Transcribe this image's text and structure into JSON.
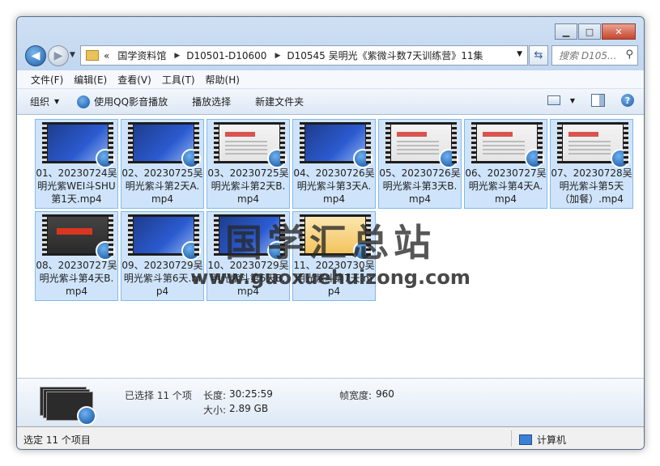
{
  "window": {
    "caption_buttons": [
      "▁",
      "□",
      "✕"
    ]
  },
  "address": {
    "root_marker": "«",
    "crumbs": [
      "国学资料馆",
      "D10501-D10600",
      "D10545 吴明光《紫微斗数7天训练营》11集"
    ],
    "search_placeholder": "搜索 D105..."
  },
  "menu": [
    "文件(F)",
    "编辑(E)",
    "查看(V)",
    "工具(T)",
    "帮助(H)"
  ],
  "toolbar": {
    "organize": "组织",
    "play_qq": "使用QQ影音播放",
    "play_select": "播放选择",
    "new_folder": "新建文件夹"
  },
  "files": [
    {
      "name": "01、20230724吴明光紫WEI斗SHU第1天.mp4",
      "thumb": "blue"
    },
    {
      "name": "02、20230725吴明光紫斗第2天A.mp4",
      "thumb": "blue"
    },
    {
      "name": "03、20230725吴明光紫斗第2天B.mp4",
      "thumb": "light"
    },
    {
      "name": "04、20230726吴明光紫斗第3天A.mp4",
      "thumb": "blue"
    },
    {
      "name": "05、20230726吴明光紫斗第3天B.mp4",
      "thumb": "light"
    },
    {
      "name": "06、20230727吴明光紫斗第4天A.mp4",
      "thumb": "light"
    },
    {
      "name": "07、20230728吴明光紫斗第5天（加餐）.mp4",
      "thumb": "light"
    },
    {
      "name": "08、20230727吴明光紫斗第4天B.mp4",
      "thumb": "red"
    },
    {
      "name": "09、20230729吴明光紫斗第6天.mp4",
      "thumb": "blue"
    },
    {
      "name": "10、20230729吴明光紫斗第6天B.mp4",
      "thumb": "blue"
    },
    {
      "name": "11、20230730吴明光紫斗第7天.mp4",
      "thumb": "promo"
    }
  ],
  "watermark": {
    "title": "国学汇总站",
    "url": "www.guoxuehuizong.com"
  },
  "details": {
    "selected": "已选择 11 个项",
    "length_label": "长度:",
    "length_value": "30:25:59",
    "size_label": "大小:",
    "size_value": "2.89 GB",
    "frame_width_label": "帧宽度:",
    "frame_width_value": "960"
  },
  "status": {
    "left": "选定 11 个项目",
    "right": "计算机"
  },
  "colors": {
    "selection_fill": "#cfe4fa",
    "selection_border": "#82b7ec",
    "chrome": "#bcd3ee"
  }
}
